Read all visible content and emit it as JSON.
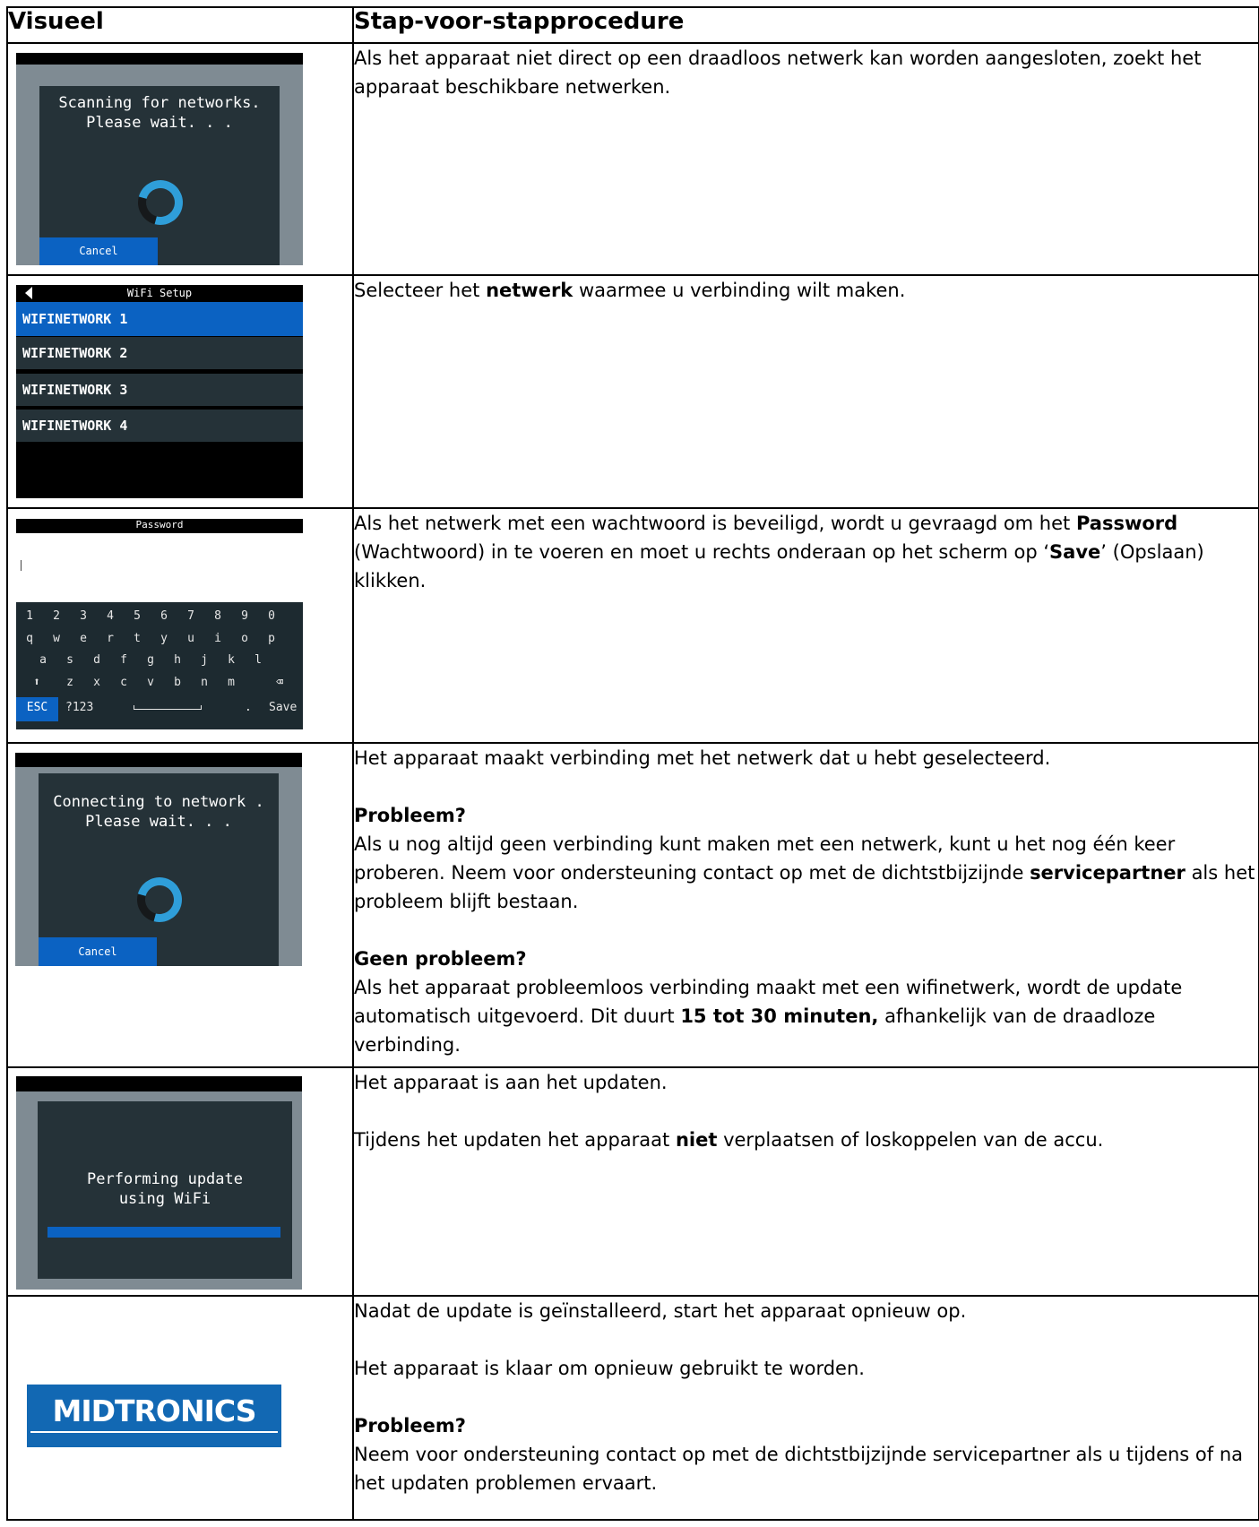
{
  "header": {
    "col1": "Visueel",
    "col2": "Stap-voor-stapprocedure"
  },
  "rows": [
    {
      "screen": {
        "message_line1": "Scanning for networks.",
        "message_line2": "Please wait. . .",
        "cancel": "Cancel"
      },
      "text": "Als het apparaat niet direct op een draadloos netwerk kan worden aangesloten, zoekt het apparaat beschikbare netwerken."
    },
    {
      "screen": {
        "title": "WiFi Setup",
        "networks": [
          "WIFINETWORK 1",
          "WIFINETWORK 2",
          "WIFINETWORK 3",
          "WIFINETWORK 4"
        ],
        "back_icon": "back-arrow-icon"
      },
      "text_pre": "Selecteer het ",
      "text_bold": "netwerk",
      "text_post": " waarmee u verbinding wilt maken."
    },
    {
      "screen": {
        "title": "Password",
        "keys_row1": [
          "1",
          "2",
          "3",
          "4",
          "5",
          "6",
          "7",
          "8",
          "9",
          "0"
        ],
        "keys_row2": [
          "q",
          "w",
          "e",
          "r",
          "t",
          "y",
          "u",
          "i",
          "o",
          "p"
        ],
        "keys_row3": [
          "a",
          "s",
          "d",
          "f",
          "g",
          "h",
          "j",
          "k",
          "l"
        ],
        "keys_row4": [
          "z",
          "x",
          "c",
          "v",
          "b",
          "n",
          "m"
        ],
        "esc": "ESC",
        "sym": "?123",
        "dot": ".",
        "save": "Save",
        "shift_icon": "shift-arrow-icon",
        "backspace_icon": "backspace-icon"
      },
      "text_1": "Als het netwerk met een wachtwoord is beveiligd, wordt u gevraagd om het ",
      "text_bold_1": "Password",
      "text_2": " (Wachtwoord) in te voeren en moet u rechts onderaan op het scherm op ‘",
      "text_bold_2": "Save",
      "text_3": "’ (Opslaan) klikken."
    },
    {
      "screen": {
        "message_line1": "Connecting to network .",
        "message_line2": "Please wait. . .",
        "cancel": "Cancel"
      },
      "text_intro": "Het apparaat maakt verbinding met het netwerk dat u hebt geselecteerd.",
      "problem_heading": "Probleem?",
      "problem_1": "Als u nog altijd geen verbinding kunt maken met een netwerk, kunt u het nog één keer proberen. Neem voor ondersteuning contact op met de dichtstbijzijnde ",
      "problem_bold": "servicepartner",
      "problem_2": " als het probleem blijft bestaan.",
      "ok_heading": "Geen probleem?",
      "ok_1": "Als het apparaat probleemloos verbinding maakt met een wifinetwerk, wordt de update automatisch uitgevoerd. Dit duurt ",
      "ok_bold": "15 tot 30 minuten,",
      "ok_2": " afhankelijk van de draadloze verbinding."
    },
    {
      "screen": {
        "message_line1": "Performing update",
        "message_line2": "using WiFi",
        "progress": 1.0
      },
      "text_1": "Het apparaat is aan het updaten.",
      "text_2_pre": "Tijdens het updaten het apparaat ",
      "text_2_bold": "niet",
      "text_2_post": " verplaatsen of loskoppelen van de accu."
    },
    {
      "screen": {
        "logo_text": "MIDTRONICS"
      },
      "text_1": "Nadat de update is geïnstalleerd, start het apparaat opnieuw op.",
      "text_2": "Het apparaat is klaar om opnieuw gebruikt te worden.",
      "problem_heading": "Probleem?",
      "problem_text": "Neem voor ondersteuning contact op met de dichtstbijzijnde servicepartner als u tijdens of na het updaten problemen ervaart."
    }
  ],
  "colors": {
    "screen_bg": "#253238",
    "frame": "#7f8b93",
    "accent": "#0b62c2",
    "spinner": "#2f9ed9"
  }
}
